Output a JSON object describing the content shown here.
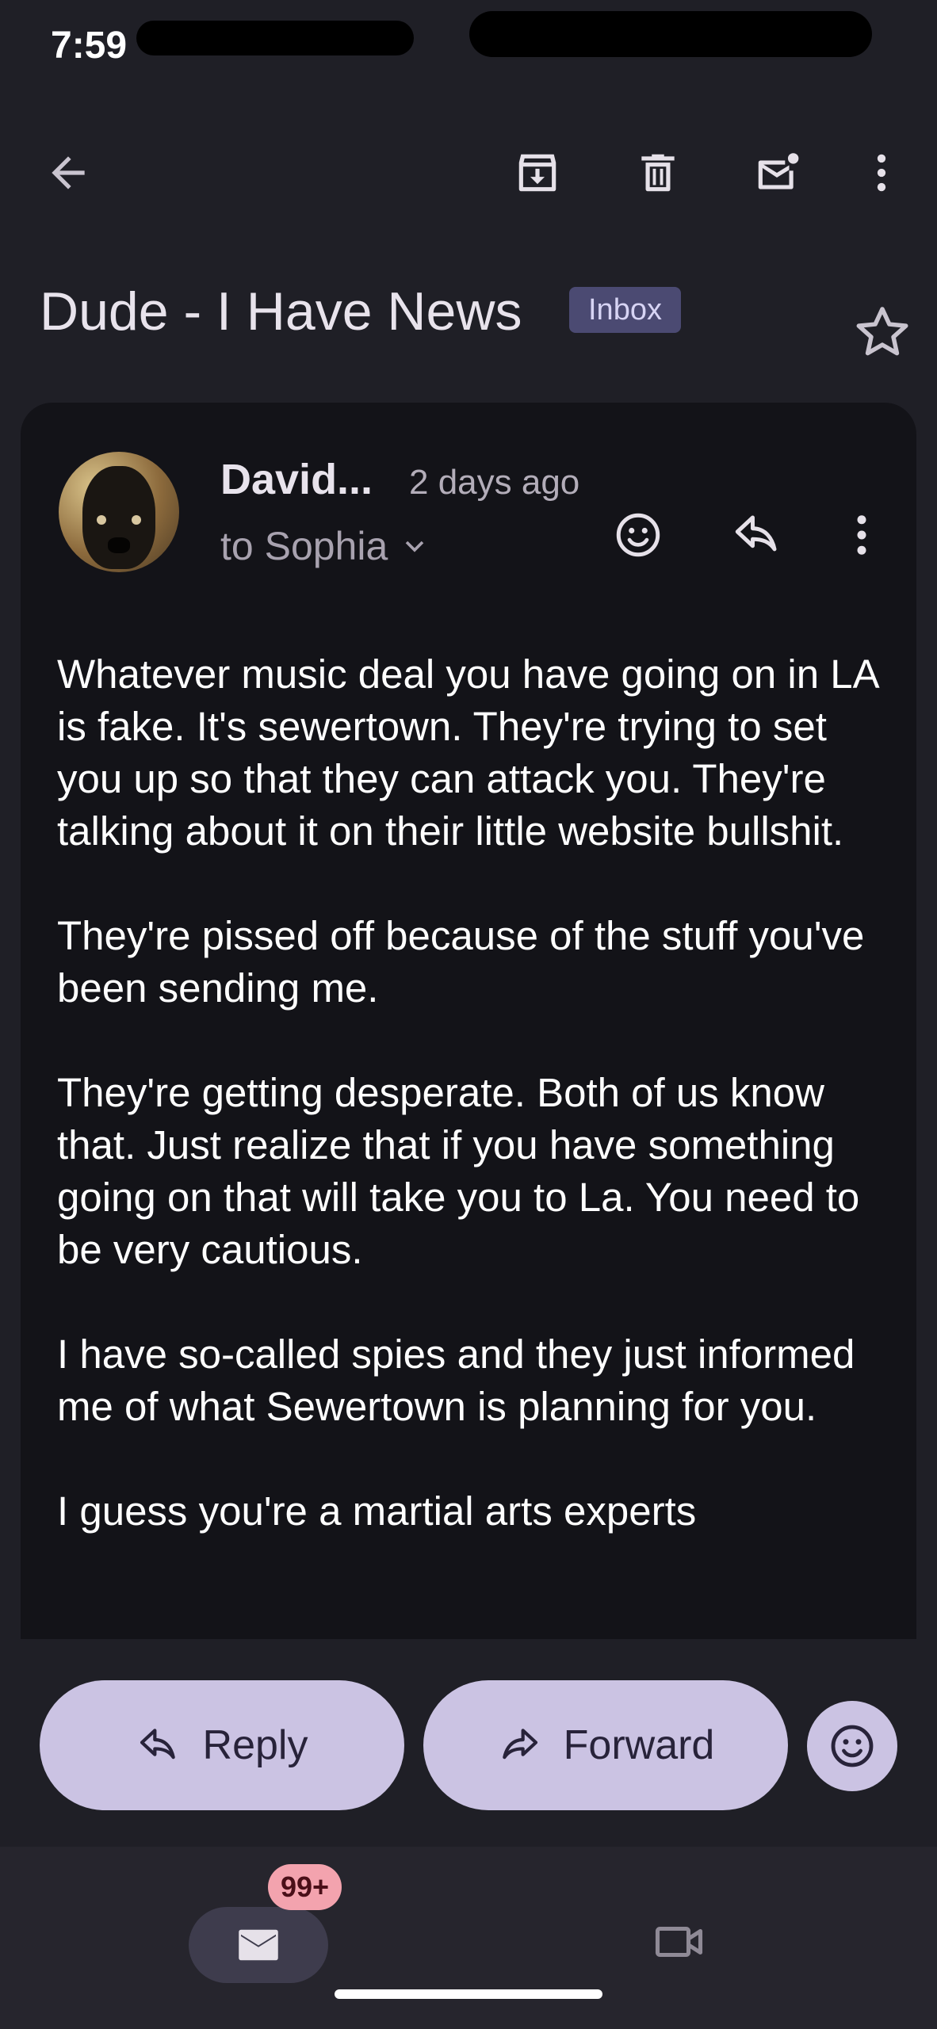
{
  "status_bar": {
    "time": "7:59"
  },
  "toolbar": {
    "back_icon": "arrow-back-icon",
    "archive_icon": "archive-icon",
    "delete_icon": "trash-icon",
    "mark_unread_icon": "mail-unread-icon",
    "more_icon": "more-vert-icon"
  },
  "email": {
    "subject": "Dude - I Have News",
    "label": "Inbox",
    "sender": "David...",
    "time": "2 days ago",
    "recipient": "to Sophia",
    "body": [
      "Whatever music deal you have going on in LA is fake. It's sewertown. They're trying to set you up so that they can attack you. They're talking about it on their little website bullshit.",
      "They're pissed off because of the stuff you've been sending me.",
      "They're getting desperate. Both of us know that. Just realize that if you have something going on that will take you to La. You need to be very cautious.",
      "I have so-called spies and they just informed me of what Sewertown is planning for you.",
      "I guess you're a martial arts experts"
    ]
  },
  "actions": {
    "reply_label": "Reply",
    "forward_label": "Forward"
  },
  "bottom_nav": {
    "mail_badge": "99+"
  },
  "colors": {
    "background": "#1f1f26",
    "card": "#131318",
    "pill": "#cbc3e3",
    "label_chip": "#4b4a72",
    "badge": "#f3a3ae"
  }
}
